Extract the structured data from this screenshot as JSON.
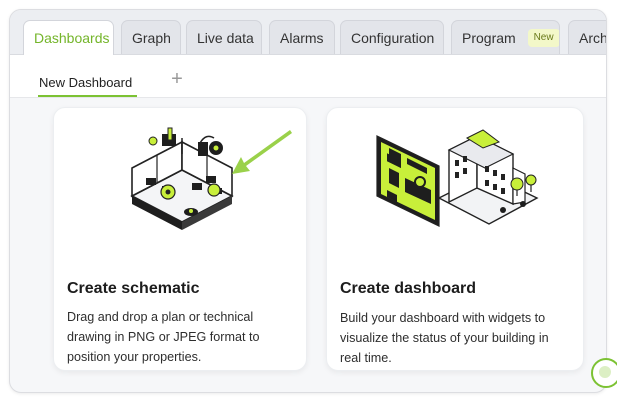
{
  "tabs": [
    {
      "label": "Dashboards",
      "active": true
    },
    {
      "label": "Graph"
    },
    {
      "label": "Live data"
    },
    {
      "label": "Alarms"
    },
    {
      "label": "Configuration"
    },
    {
      "label": "Program",
      "badge": "New"
    },
    {
      "label": "Arch"
    }
  ],
  "subtabs": {
    "current": "New Dashboard",
    "add_label": "+"
  },
  "cards": [
    {
      "title": "Create schematic",
      "description": "Drag and drop a plan or technical drawing in PNG or JPEG format to position your properties."
    },
    {
      "title": "Create dashboard",
      "description": "Build your dashboard with widgets to visualize the status of your building in real time."
    }
  ],
  "colors": {
    "accent": "#7cc233",
    "lime": "#c8ef3a",
    "dark": "#1e1e1e"
  },
  "icons": {
    "add": "plus-icon",
    "illustration_1": "schematic-illustration",
    "illustration_2": "dashboard-illustration"
  }
}
